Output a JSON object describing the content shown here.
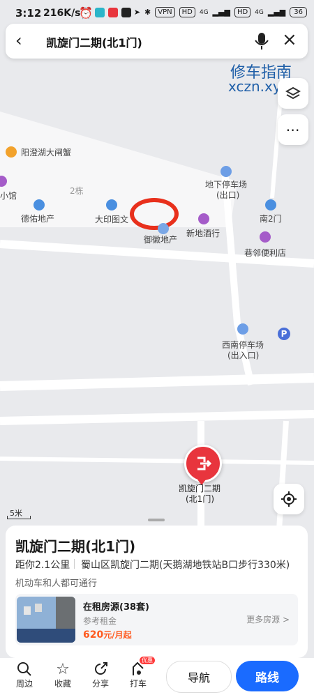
{
  "status_bar": {
    "time": "3:12",
    "speed": "216K/s",
    "vpn": "VPN",
    "hd1": "HD",
    "net1": "4G",
    "hd2": "HD",
    "net2": "4G",
    "battery": "36"
  },
  "search": {
    "query": "凯旋门二期(北1门)"
  },
  "watermark": {
    "line1": "修车指南",
    "line2": "xczn.xyz"
  },
  "map": {
    "labels": {
      "crab": "阳澄湖大闸蟹",
      "shop_small": "小馆",
      "building2": "2栋",
      "deyou": "德佑地产",
      "dayin": "大印图文",
      "yuhui": "御徽地产",
      "xindi": "新地酒行",
      "parking_north_1": "地下停车场",
      "parking_north_2": "(出口)",
      "south_gate2": "南2门",
      "xianglin": "巷邻便利店",
      "parking_sw_1": "西南停车场",
      "parking_sw_2": "(出入口)",
      "pin_1": "凯旋门二期",
      "pin_2": "(北1门)",
      "scale": "5米"
    },
    "pin_color": "#e8353d"
  },
  "card": {
    "title": "凯旋门二期(北1门)",
    "distance": "距你2.1公里",
    "address": "蜀山区凯旋门二期(天鹅湖地铁站B口步行330米)",
    "access": "机动车和人都可通行",
    "rental": {
      "title": "在租房源(38套)",
      "subtitle": "参考租金",
      "price": "620",
      "price_unit": "元/月起",
      "more": "更多房源 >"
    }
  },
  "nav": {
    "nearby": "周边",
    "favorite": "收藏",
    "share": "分享",
    "taxi": "打车",
    "taxi_badge": "优惠",
    "navigate": "导航",
    "route": "路线"
  },
  "colors": {
    "accent": "#1a6bff",
    "price": "#ff5a1f",
    "annotation": "#e8301c"
  }
}
